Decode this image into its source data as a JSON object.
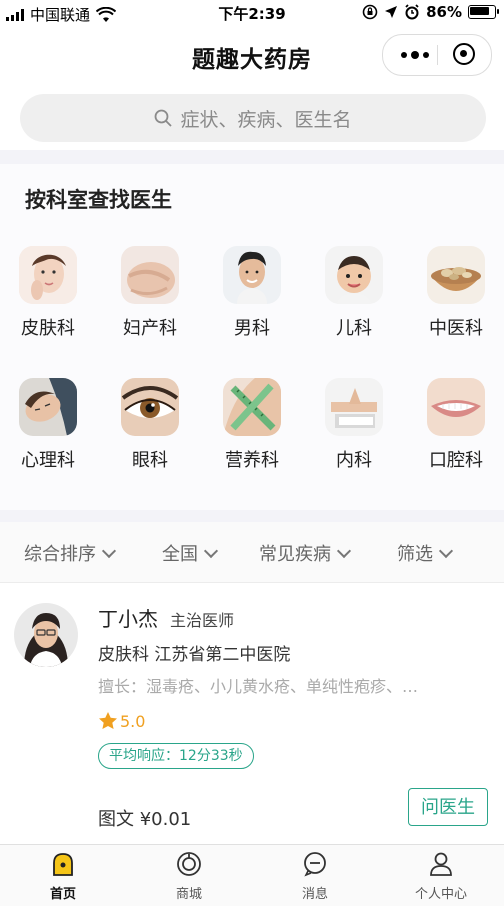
{
  "status_bar": {
    "carrier": "中国联通",
    "time": "下午2:39",
    "battery": "86%"
  },
  "nav": {
    "title": "题趣大药房"
  },
  "search": {
    "placeholder": "症状、疾病、医生名"
  },
  "departments": {
    "title": "按科室查找医生",
    "items": [
      {
        "label": "皮肤科",
        "icon": "skin-icon"
      },
      {
        "label": "妇产科",
        "icon": "pregnancy-icon"
      },
      {
        "label": "男科",
        "icon": "male-icon"
      },
      {
        "label": "儿科",
        "icon": "child-icon"
      },
      {
        "label": "中医科",
        "icon": "herb-icon"
      },
      {
        "label": "心理科",
        "icon": "mind-icon"
      },
      {
        "label": "眼科",
        "icon": "eye-icon"
      },
      {
        "label": "营养科",
        "icon": "tape-icon"
      },
      {
        "label": "内科",
        "icon": "pill-icon"
      },
      {
        "label": "口腔科",
        "icon": "tooth-icon"
      }
    ]
  },
  "filters": [
    "综合排序",
    "全国",
    "常见疾病",
    "筛选"
  ],
  "doctor": {
    "name": "丁小杰",
    "title": "主治医师",
    "dept_hospital": "皮肤科 江苏省第二中医院",
    "skill": "擅长：湿毒疮、小儿黄水疮、单纯性疱疹、…",
    "rating": "5.0",
    "response": "平均响应：12分33秒",
    "price": "图文 ¥0.01",
    "ask_label": "问医生"
  },
  "tabbar": [
    {
      "label": "首页",
      "icon": "home-icon",
      "active": true
    },
    {
      "label": "商城",
      "icon": "mall-icon",
      "active": false
    },
    {
      "label": "消息",
      "icon": "message-icon",
      "active": false
    },
    {
      "label": "个人中心",
      "icon": "user-icon",
      "active": false
    }
  ],
  "colors": {
    "accent": "#2aa58a",
    "star": "#f0a020"
  }
}
